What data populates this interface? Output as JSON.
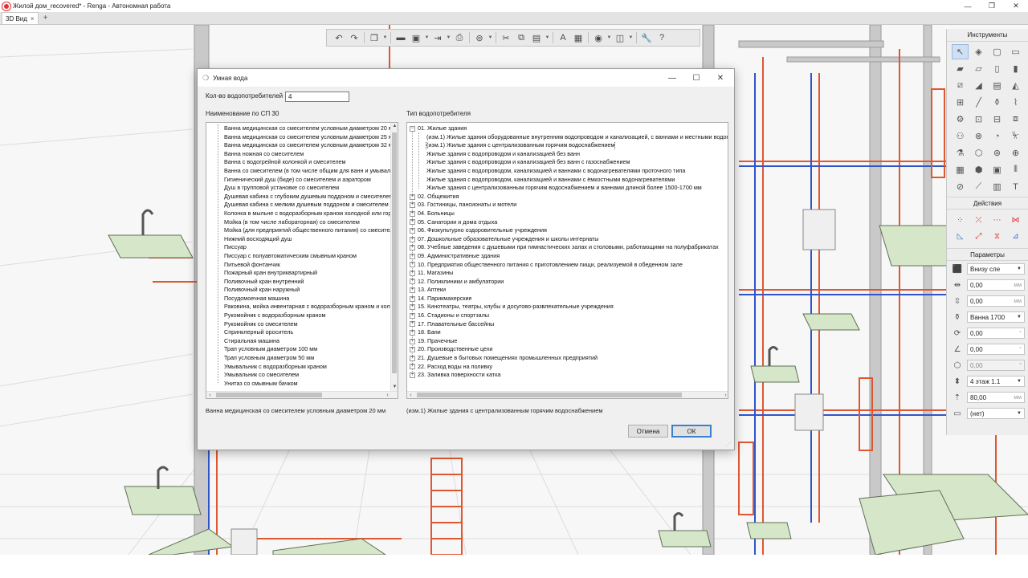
{
  "window": {
    "title": "Жилой дом_recovered* - Renga - Автономная работа",
    "controls": [
      "—",
      "❐",
      "✕"
    ]
  },
  "tabs": [
    {
      "label": "3D Вид",
      "close": "×"
    }
  ],
  "tab_add": "+",
  "toolbar": {
    "icons": [
      "undo-icon",
      "redo-icon",
      "cube-view-icon",
      "open-folder-icon",
      "save-icon",
      "export-icon",
      "print-icon",
      "snap-icon",
      "cut-icon",
      "copy-icon",
      "paste-icon",
      "text-style-icon",
      "image-icon",
      "visibility-icon",
      "layers-icon",
      "settings-wrench-icon",
      "help-icon"
    ]
  },
  "right_panel": {
    "tools_header": "Инструменты",
    "actions_header": "Действия",
    "params_header": "Параметры",
    "params": [
      {
        "icon": "placement-icon",
        "value": "Внизу сле",
        "unit": "",
        "dropdown": true
      },
      {
        "icon": "offset-x-icon",
        "value": "0,00",
        "unit": "мм",
        "dropdown": false
      },
      {
        "icon": "offset-y-icon",
        "value": "0,00",
        "unit": "мм",
        "dropdown": false
      },
      {
        "icon": "style-icon",
        "value": "Ванна 1700",
        "unit": "",
        "dropdown": true
      },
      {
        "icon": "rotation-icon",
        "value": "0,00",
        "unit": "°",
        "dropdown": false
      },
      {
        "icon": "angle-icon",
        "value": "0,00",
        "unit": "°",
        "dropdown": false
      },
      {
        "icon": "tilt-icon",
        "value": "0,00",
        "unit": "°",
        "dropdown": false,
        "disabled": true
      },
      {
        "icon": "level-icon",
        "value": "4 этаж 1.1",
        "unit": "",
        "dropdown": true
      },
      {
        "icon": "elevation-icon",
        "value": "80,00",
        "unit": "мм",
        "dropdown": false
      },
      {
        "icon": "marking-icon",
        "value": "(нет)",
        "unit": "",
        "dropdown": true
      }
    ]
  },
  "dialog": {
    "title": "Умная вода",
    "count_label": "Кол-во водопотребителей",
    "count_value": "4",
    "left_label": "Наименование по СП 30",
    "right_label": "Тип водопотребителя",
    "left_items": [
      "Ванна медицинская со смесителем условным диаметром 20 мм",
      "Ванна медицинская со смесителем условным диаметром 25 мм",
      "Ванна медицинская со смесителем условным диаметром 32 мм",
      "Ванна ножная со смесителем",
      "Ванна с водогрейной колонкой и смесителем",
      "Ванна со смесителем (в том числе общим для ванн и умывальников)",
      "Гигиенический душ (биде) со смесителем и аэратором",
      "Душ в групповой установке со смесителем",
      "Душевая кабина с глубоким душевым поддоном и смесителем",
      "Душевая кабина с мелким душевым поддоном и смесителем",
      "Колонка в мыльне с водоразборным краном холодной или горячей воды",
      "Мойка (в том числе лабораторная) со смесителем",
      "Мойка (для предприятий общественного питания) со смесителем",
      "Нижний восходящий душ",
      "Писсуар",
      "Писсуар с полуавтоматическим смывным краном",
      "Питьевой фонтанчик",
      "Пожарный кран внутриквартирный",
      "Поливочный кран внутренний",
      "Поливочный кран наружный",
      "Посудомоечная машина",
      "Раковина, мойка инвентарная с водоразборным краном и колонкой",
      "Рукомойник с водоразборным краном",
      "Рукомойник со смесителем",
      "Спринклерный ороситель",
      "Стиральная машина",
      "Трап условным диаметром 100 мм",
      "Трап условным диаметром 50 мм",
      "Умывальник с водоразборным краном",
      "Умывальник со смесителем",
      "Унитаз со смывным бачком"
    ],
    "tree": [
      {
        "label": "01. Жилые здания",
        "expanded": true,
        "children": [
          "(изм.1) Жилые здания оборудованные внутренним водопроводом и канализацией, с ваннами и местными водонагревателями",
          "(изм.1) Жилые здания с централизованным горячим водоснабжением",
          "Жилые здания с водопроводом и канализацией без ванн",
          "Жилые здания с водопроводом и канализацией без ванн с газоснабжением",
          "Жилые здания с водопроводом, канализацией и ваннами с водонагревателями проточного типа",
          "Жилые здания с водопроводом, канализацией и ваннами с ёмкостными водонагревателями",
          "Жилые здания с централизованным горячим водоснабжением и ваннами длиной более 1500-1700 мм"
        ]
      },
      {
        "label": "02. Общежития"
      },
      {
        "label": "03. Гостиницы, пансионаты и мотели"
      },
      {
        "label": "04. Больницы"
      },
      {
        "label": "05. Санатории и дома отдыха"
      },
      {
        "label": "06. Физкультурно оздоровительные учреждения"
      },
      {
        "label": "07. Дошкольные образовательные учреждения и школы интернаты"
      },
      {
        "label": "08. Учебные заведения с душевыми при гимнастических залах и столовыми, работающими на полуфабрикатах"
      },
      {
        "label": "09. Административные здания"
      },
      {
        "label": "10. Предприятия общественного питания с приготовлением пищи, реализуемой в обеденном зале"
      },
      {
        "label": "11. Магазины"
      },
      {
        "label": "12. Поликлиники и амбулатории"
      },
      {
        "label": "13. Аптеки"
      },
      {
        "label": "14. Парикмахерские"
      },
      {
        "label": "15. Кинотеатры, театры, клубы и досугово-развлекательные учреждения"
      },
      {
        "label": "16. Стадионы и спортзалы"
      },
      {
        "label": "17. Плавательные бассейны"
      },
      {
        "label": "18. Бани"
      },
      {
        "label": "19. Прачечные"
      },
      {
        "label": "20. Производственные цехи"
      },
      {
        "label": "21. Душевые в бытовых помещениях промышленных предприятий"
      },
      {
        "label": "22. Расход воды на поливку"
      },
      {
        "label": "23. Заливка поверхности катка"
      }
    ],
    "selected_left": "Ванна медицинская со смесителем условным диаметром 20 мм",
    "selected_right": "(изм.1) Жилые здания с централизованным горячим водоснабжением",
    "cancel_label": "Отмена",
    "ok_label": "ОК"
  },
  "colors": {
    "pipe_red": "#e0562e",
    "pipe_blue": "#2f55c9",
    "fixture_green": "#d6e6c8",
    "pipe_grey": "#b5b5b5"
  }
}
